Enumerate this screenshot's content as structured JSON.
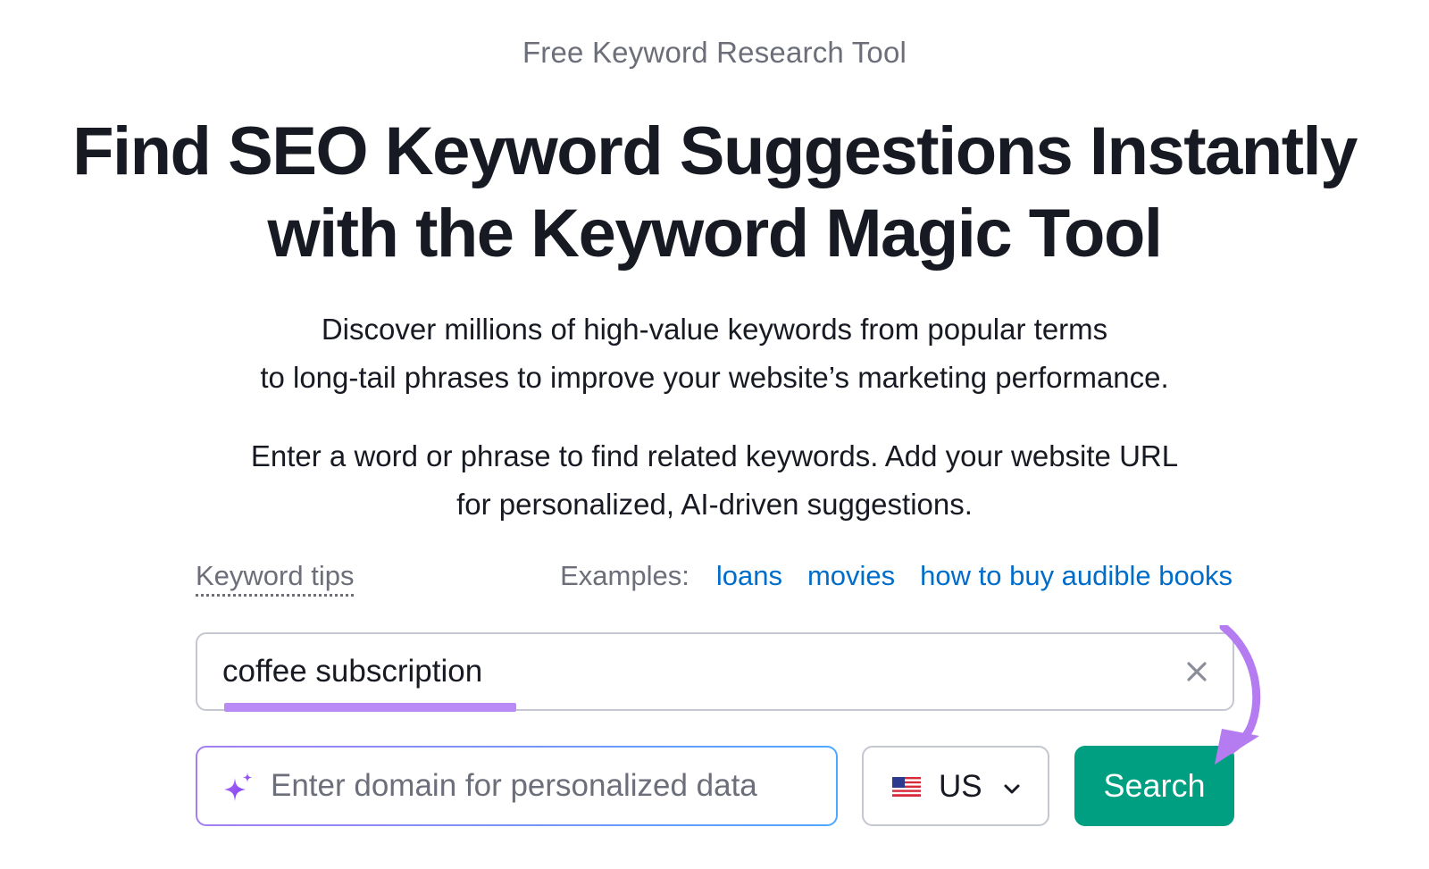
{
  "header": {
    "eyebrow": "Free Keyword Research Tool",
    "headline_line1": "Find SEO Keyword Suggestions Instantly",
    "headline_line2": "with the Keyword Magic Tool"
  },
  "description": {
    "line1": "Discover millions of high-value keywords from popular terms",
    "line2": "to long-tail phrases to improve your website’s marketing performance."
  },
  "instructions": {
    "line1": "Enter a word or phrase to find related keywords. Add your website URL",
    "line2": "for personalized, AI-driven suggestions."
  },
  "tips": {
    "label": "Keyword tips",
    "examples_label": "Examples:",
    "examples": [
      "loans",
      "movies",
      "how to buy audible books"
    ]
  },
  "keyword_input": {
    "value": "coffee subscription"
  },
  "domain_input": {
    "placeholder": "Enter domain for personalized data",
    "icon": "sparkle-icon"
  },
  "country_select": {
    "value": "US",
    "icon": "us-flag-icon"
  },
  "search_button": {
    "label": "Search",
    "color": "#009f81"
  },
  "colors": {
    "text": "#171a22",
    "muted": "#6c6e79",
    "link": "#006dca",
    "highlight": "#b98cf5"
  }
}
